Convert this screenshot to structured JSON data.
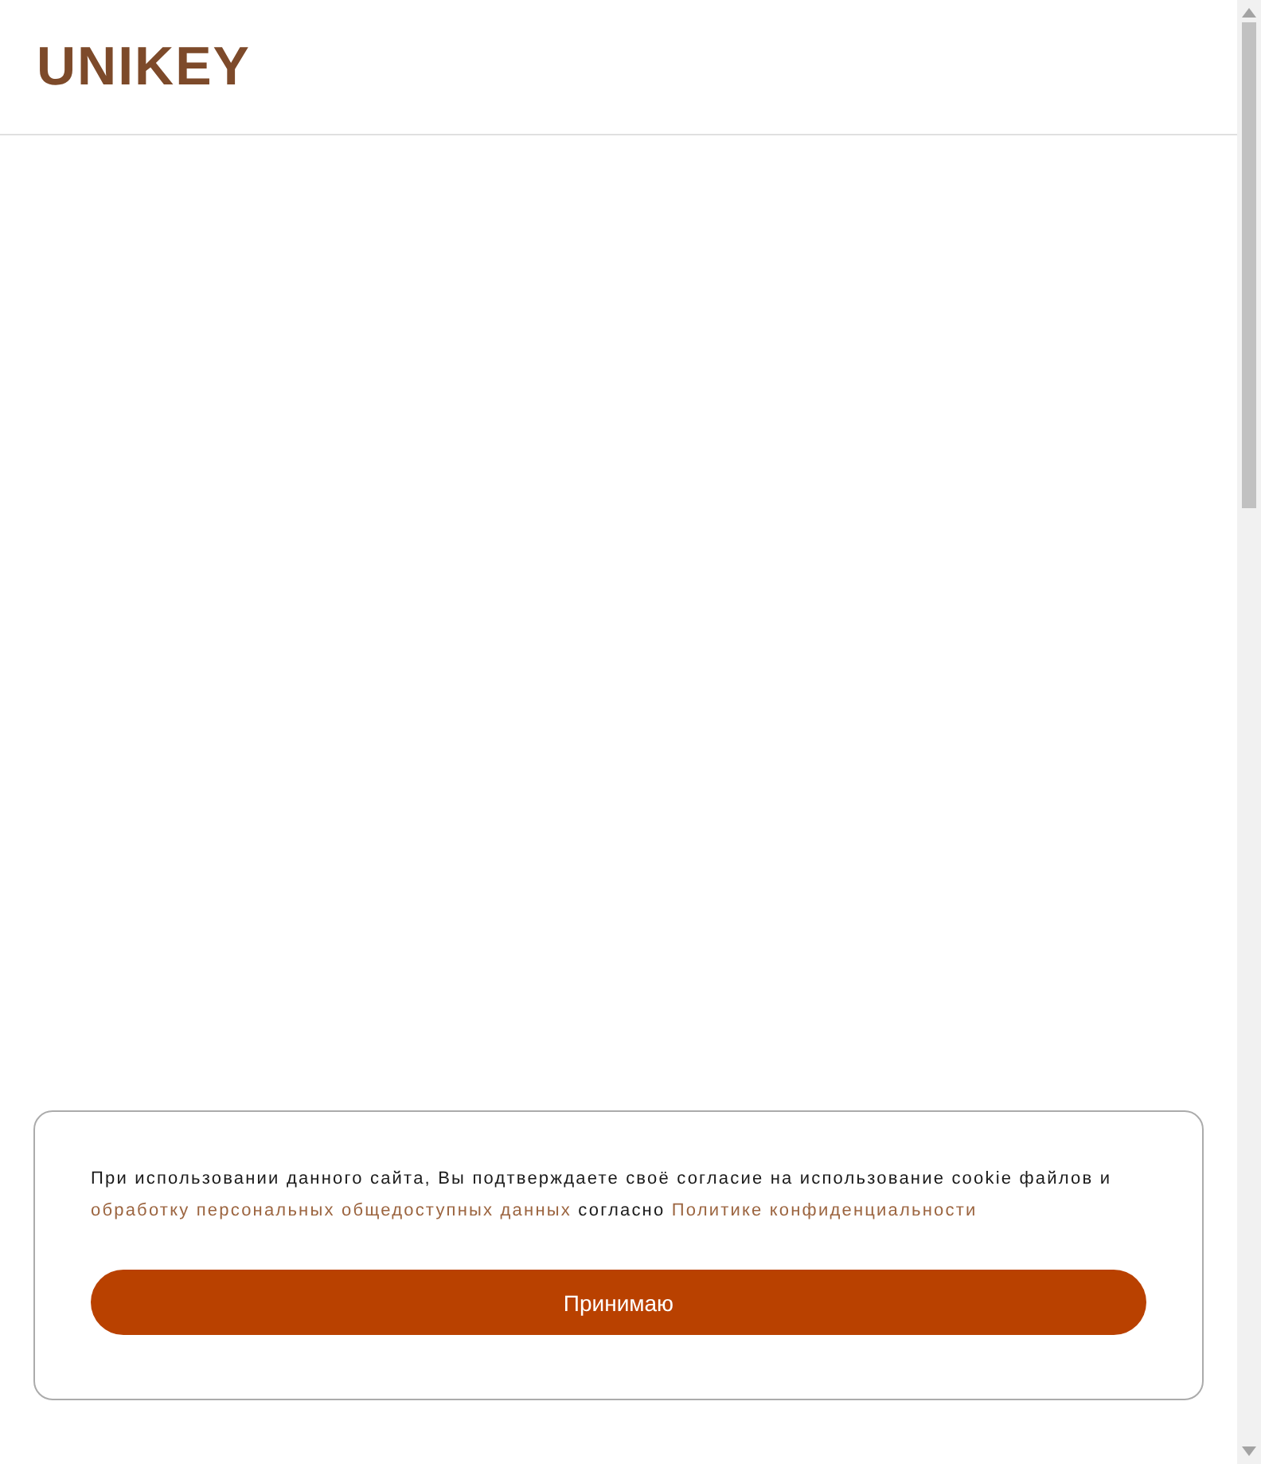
{
  "header": {
    "logo": "UNIKEY"
  },
  "cookie_banner": {
    "text": [
      {
        "kind": "text",
        "text": "При использовании данного сайта, Вы подтверждаете своё согласие на использование cookie файлов и "
      },
      {
        "kind": "link",
        "text": "обработку персональных общедоступных данных"
      },
      {
        "kind": "text",
        "text": " согласно "
      },
      {
        "kind": "link",
        "text": "Политике конфиденциальности"
      }
    ],
    "button": "Принимаю"
  }
}
